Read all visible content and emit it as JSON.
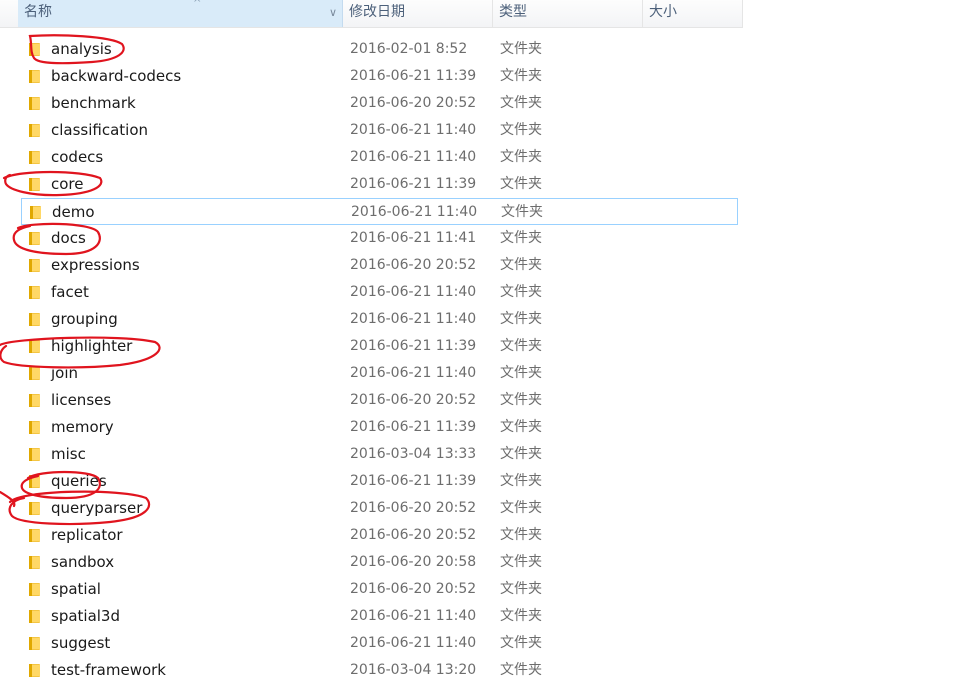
{
  "columns": {
    "name": "名称",
    "date": "修改日期",
    "type": "类型",
    "size": "大小"
  },
  "rows": [
    {
      "name": "analysis",
      "date": "2016-02-01 8:52",
      "type": "文件夹"
    },
    {
      "name": "backward-codecs",
      "date": "2016-06-21 11:39",
      "type": "文件夹"
    },
    {
      "name": "benchmark",
      "date": "2016-06-20 20:52",
      "type": "文件夹"
    },
    {
      "name": "classification",
      "date": "2016-06-21 11:40",
      "type": "文件夹"
    },
    {
      "name": "codecs",
      "date": "2016-06-21 11:40",
      "type": "文件夹"
    },
    {
      "name": "core",
      "date": "2016-06-21 11:39",
      "type": "文件夹"
    },
    {
      "name": "demo",
      "date": "2016-06-21 11:40",
      "type": "文件夹"
    },
    {
      "name": "docs",
      "date": "2016-06-21 11:41",
      "type": "文件夹"
    },
    {
      "name": "expressions",
      "date": "2016-06-20 20:52",
      "type": "文件夹"
    },
    {
      "name": "facet",
      "date": "2016-06-21 11:40",
      "type": "文件夹"
    },
    {
      "name": "grouping",
      "date": "2016-06-21 11:40",
      "type": "文件夹"
    },
    {
      "name": "highlighter",
      "date": "2016-06-21 11:39",
      "type": "文件夹"
    },
    {
      "name": "join",
      "date": "2016-06-21 11:40",
      "type": "文件夹"
    },
    {
      "name": "licenses",
      "date": "2016-06-20 20:52",
      "type": "文件夹"
    },
    {
      "name": "memory",
      "date": "2016-06-21 11:39",
      "type": "文件夹"
    },
    {
      "name": "misc",
      "date": "2016-03-04 13:33",
      "type": "文件夹"
    },
    {
      "name": "queries",
      "date": "2016-06-21 11:39",
      "type": "文件夹"
    },
    {
      "name": "queryparser",
      "date": "2016-06-20 20:52",
      "type": "文件夹"
    },
    {
      "name": "replicator",
      "date": "2016-06-20 20:52",
      "type": "文件夹"
    },
    {
      "name": "sandbox",
      "date": "2016-06-20 20:58",
      "type": "文件夹"
    },
    {
      "name": "spatial",
      "date": "2016-06-20 20:52",
      "type": "文件夹"
    },
    {
      "name": "spatial3d",
      "date": "2016-06-21 11:40",
      "type": "文件夹"
    },
    {
      "name": "suggest",
      "date": "2016-06-21 11:40",
      "type": "文件夹"
    },
    {
      "name": "test-framework",
      "date": "2016-03-04 13:20",
      "type": "文件夹"
    }
  ],
  "focused_row": "demo",
  "circled_rows": [
    "analysis",
    "core",
    "docs",
    "highlighter",
    "queries",
    "queryparser"
  ],
  "colors": {
    "folder": "#f4c542",
    "annotation": "#e0141e",
    "focus_border": "#99d1ff",
    "header_text": "#4c607a"
  },
  "icons": {
    "folder": "folder-icon",
    "sort": "chevron-down-icon"
  }
}
